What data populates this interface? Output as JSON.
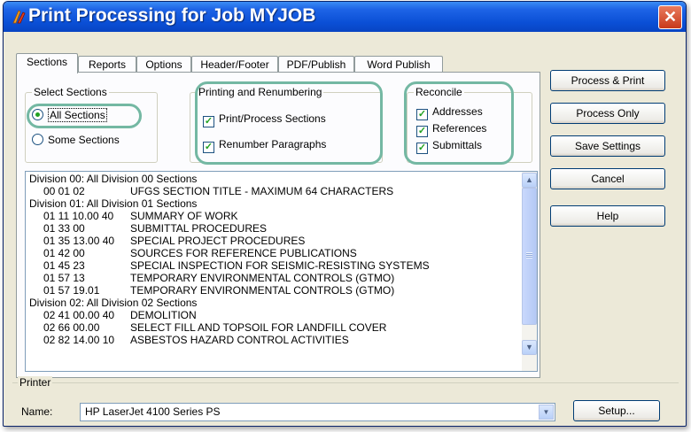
{
  "window": {
    "title": "Print Processing for Job MYJOB",
    "close_label": "✕"
  },
  "tabs": [
    {
      "label": "Sections",
      "active": true
    },
    {
      "label": "Reports",
      "active": false
    },
    {
      "label": "Options",
      "active": false
    },
    {
      "label": "Header/Footer",
      "active": false
    },
    {
      "label": "PDF/Publish",
      "active": false
    },
    {
      "label": "Word Publish",
      "active": false
    }
  ],
  "select_sections": {
    "title": "Select Sections",
    "all_label": "All Sections",
    "some_label": "Some Sections",
    "selected": "All Sections"
  },
  "printing": {
    "title": "Printing and Renumbering",
    "print_process_label": "Print/Process Sections",
    "print_process_checked": true,
    "renumber_label": "Renumber Paragraphs",
    "renumber_checked": true
  },
  "reconcile": {
    "title": "Reconcile",
    "addresses_label": "Addresses",
    "addresses_checked": true,
    "references_label": "References",
    "references_checked": true,
    "submittals_label": "Submittals",
    "submittals_checked": true
  },
  "section_list": [
    {
      "kind": "division",
      "text": "Division 00: All Division 00 Sections"
    },
    {
      "kind": "section",
      "number": "00 01 02",
      "title": "UFGS SECTION TITLE - MAXIMUM 64 CHARACTERS"
    },
    {
      "kind": "division",
      "text": "Division 01: All Division 01 Sections"
    },
    {
      "kind": "section",
      "number": "01 11 10.00 40",
      "title": "SUMMARY OF WORK"
    },
    {
      "kind": "section",
      "number": "01 33 00",
      "title": "SUBMITTAL PROCEDURES"
    },
    {
      "kind": "section",
      "number": "01 35 13.00 40",
      "title": "SPECIAL PROJECT PROCEDURES"
    },
    {
      "kind": "section",
      "number": "01 42 00",
      "title": "SOURCES FOR REFERENCE PUBLICATIONS"
    },
    {
      "kind": "section",
      "number": "01 45 23",
      "title": "SPECIAL INSPECTION FOR SEISMIC-RESISTING SYSTEMS"
    },
    {
      "kind": "section",
      "number": "01 57 13",
      "title": "TEMPORARY ENVIRONMENTAL CONTROLS (GTMO)"
    },
    {
      "kind": "section",
      "number": "01 57 19.01",
      "title": "TEMPORARY ENVIRONMENTAL CONTROLS (GTMO)"
    },
    {
      "kind": "division",
      "text": "Division 02: All Division 02 Sections"
    },
    {
      "kind": "section",
      "number": "02 41 00.00 40",
      "title": "DEMOLITION"
    },
    {
      "kind": "section",
      "number": "02 66 00.00",
      "title": "SELECT FILL AND TOPSOIL FOR LANDFILL COVER"
    },
    {
      "kind": "section",
      "number": "02 82 14.00 10",
      "title": "ASBESTOS HAZARD CONTROL ACTIVITIES"
    }
  ],
  "buttons": {
    "process_print": "Process & Print",
    "process_only": "Process Only",
    "save_settings": "Save Settings",
    "cancel": "Cancel",
    "help": "Help"
  },
  "printer": {
    "title": "Printer",
    "name_label": "Name:",
    "name_value": "HP LaserJet 4100 Series PS",
    "setup_label": "Setup..."
  },
  "colors": {
    "title_bar": "#0a4fd6",
    "highlight_ring": "#74b8a3",
    "dialog_bg": "#ece9d8"
  }
}
